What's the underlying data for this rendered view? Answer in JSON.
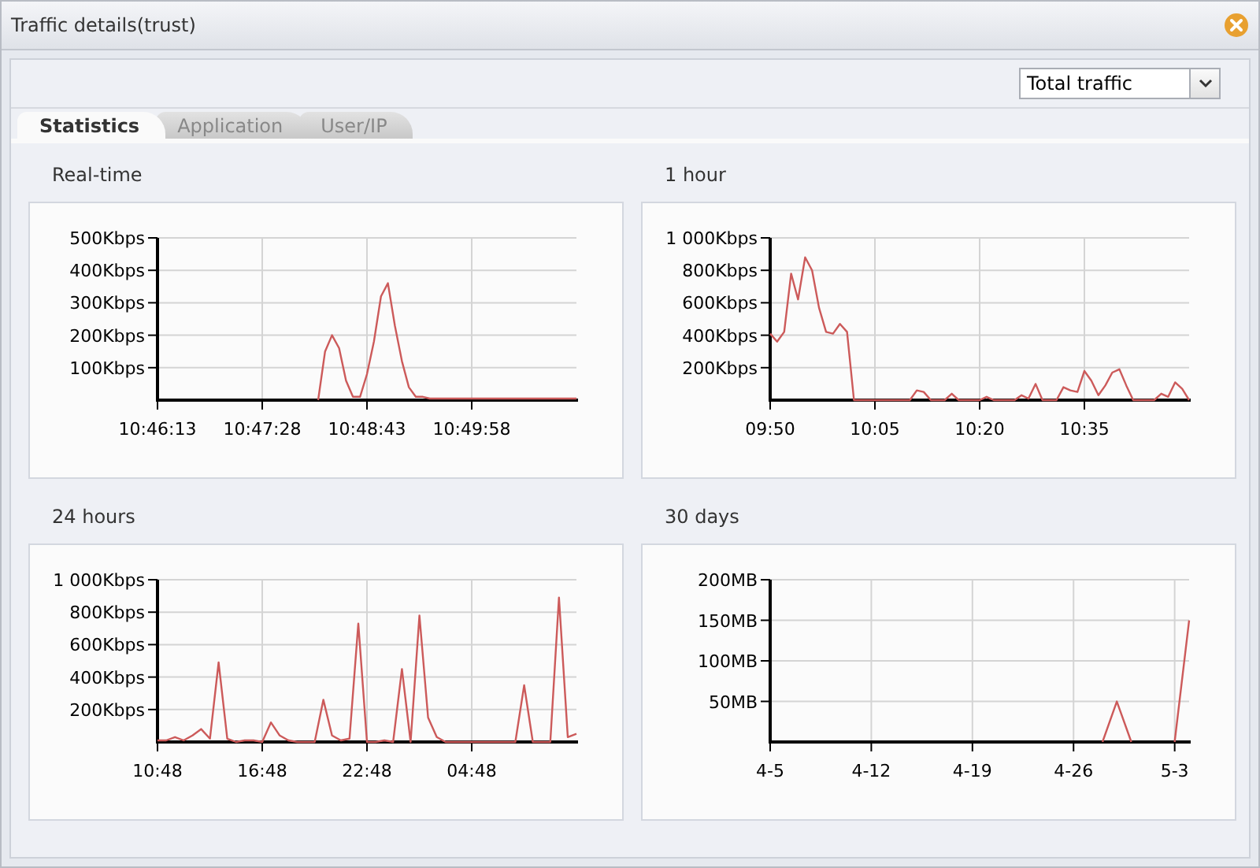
{
  "window": {
    "title": "Traffic details(trust)"
  },
  "filter": {
    "value": "Total traffic"
  },
  "tabs": [
    {
      "label": "Statistics",
      "selected": true
    },
    {
      "label": "Application",
      "selected": false
    },
    {
      "label": "User/IP",
      "selected": false
    }
  ],
  "panels": [
    {
      "title": "Real-time",
      "chart_data": {
        "type": "line",
        "categories": [
          "10:46:13",
          null,
          null,
          null,
          null,
          null,
          null,
          null,
          null,
          null,
          null,
          null,
          null,
          null,
          null,
          "10:47:28",
          null,
          null,
          null,
          null,
          null,
          null,
          null,
          null,
          null,
          null,
          null,
          null,
          null,
          null,
          "10:48:43",
          null,
          null,
          null,
          null,
          null,
          null,
          null,
          null,
          null,
          null,
          null,
          null,
          null,
          null,
          "10:49:58",
          null,
          null,
          null,
          null,
          null,
          null,
          null,
          null,
          null,
          null,
          null,
          null,
          null,
          null,
          null
        ],
        "series": [
          {
            "color": "#cc5a5a",
            "values": [
              null,
              null,
              null,
              null,
              null,
              null,
              null,
              null,
              null,
              null,
              null,
              null,
              null,
              null,
              null,
              null,
              null,
              null,
              null,
              null,
              null,
              null,
              null,
              0,
              150,
              200,
              160,
              60,
              10,
              10,
              80,
              180,
              320,
              360,
              230,
              120,
              40,
              10,
              10,
              5,
              5,
              5,
              5,
              5,
              5,
              5,
              5,
              5,
              5,
              5,
              5,
              5,
              5,
              5,
              5,
              5,
              5,
              5,
              5,
              5,
              5
            ]
          }
        ],
        "grid": true,
        "ylim": [
          0,
          500
        ],
        "yticks": [
          {
            "value": 100,
            "label": "100Kbps"
          },
          {
            "value": 200,
            "label": "200Kbps"
          },
          {
            "value": 300,
            "label": "300Kbps"
          },
          {
            "value": 400,
            "label": "400Kbps"
          },
          {
            "value": 500,
            "label": "500Kbps"
          }
        ]
      }
    },
    {
      "title": "1 hour",
      "chart_data": {
        "type": "line",
        "categories": [
          "09:50",
          null,
          null,
          null,
          null,
          null,
          null,
          null,
          null,
          null,
          null,
          null,
          null,
          null,
          null,
          "10:05",
          null,
          null,
          null,
          null,
          null,
          null,
          null,
          null,
          null,
          null,
          null,
          null,
          null,
          null,
          "10:20",
          null,
          null,
          null,
          null,
          null,
          null,
          null,
          null,
          null,
          null,
          null,
          null,
          null,
          null,
          "10:35",
          null,
          null,
          null,
          null,
          null,
          null,
          null,
          null,
          null,
          null,
          null,
          null,
          null,
          null,
          null
        ],
        "series": [
          {
            "color": "#cc5a5a",
            "values": [
              410,
              360,
              420,
              780,
              620,
              880,
              800,
              570,
              420,
              410,
              470,
              420,
              0,
              0,
              0,
              0,
              0,
              0,
              0,
              0,
              0,
              60,
              50,
              0,
              0,
              0,
              40,
              0,
              0,
              0,
              0,
              20,
              0,
              0,
              0,
              0,
              30,
              10,
              100,
              0,
              0,
              0,
              80,
              60,
              50,
              180,
              120,
              30,
              90,
              170,
              190,
              90,
              0,
              0,
              0,
              0,
              40,
              20,
              110,
              70,
              0
            ]
          }
        ],
        "grid": true,
        "ylim": [
          0,
          1000
        ],
        "yticks": [
          {
            "value": 200,
            "label": "200Kbps"
          },
          {
            "value": 400,
            "label": "400Kbps"
          },
          {
            "value": 600,
            "label": "600Kbps"
          },
          {
            "value": 800,
            "label": "800Kbps"
          },
          {
            "value": 1000,
            "label": "1 000Kbps"
          }
        ]
      }
    },
    {
      "title": "24 hours",
      "chart_data": {
        "type": "line",
        "categories": [
          "10:48",
          null,
          null,
          null,
          null,
          null,
          null,
          null,
          null,
          null,
          null,
          null,
          "16:48",
          null,
          null,
          null,
          null,
          null,
          null,
          null,
          null,
          null,
          null,
          null,
          "22:48",
          null,
          null,
          null,
          null,
          null,
          null,
          null,
          null,
          null,
          null,
          null,
          "04:48",
          null,
          null,
          null,
          null,
          null,
          null,
          null,
          null,
          null,
          null,
          null,
          null
        ],
        "series": [
          {
            "color": "#cc5a5a",
            "values": [
              10,
              10,
              30,
              10,
              40,
              80,
              20,
              490,
              20,
              0,
              10,
              10,
              0,
              120,
              40,
              10,
              0,
              0,
              0,
              260,
              40,
              10,
              20,
              730,
              0,
              0,
              10,
              0,
              450,
              0,
              780,
              150,
              30,
              0,
              0,
              0,
              0,
              0,
              0,
              0,
              0,
              0,
              350,
              0,
              0,
              0,
              890,
              30,
              50
            ]
          }
        ],
        "grid": true,
        "ylim": [
          0,
          1000
        ],
        "yticks": [
          {
            "value": 200,
            "label": "200Kbps"
          },
          {
            "value": 400,
            "label": "400Kbps"
          },
          {
            "value": 600,
            "label": "600Kbps"
          },
          {
            "value": 800,
            "label": "800Kbps"
          },
          {
            "value": 1000,
            "label": "1 000Kbps"
          }
        ]
      }
    },
    {
      "title": "30 days",
      "chart_data": {
        "type": "line",
        "categories": [
          "4-5",
          null,
          null,
          null,
          null,
          null,
          null,
          "4-12",
          null,
          null,
          null,
          null,
          null,
          null,
          "4-19",
          null,
          null,
          null,
          null,
          null,
          null,
          "4-26",
          null,
          null,
          null,
          null,
          null,
          null,
          "5-3",
          null
        ],
        "series": [
          {
            "color": "#cc5a5a",
            "values": [
              null,
              null,
              null,
              null,
              null,
              null,
              null,
              null,
              null,
              null,
              null,
              null,
              null,
              null,
              null,
              null,
              null,
              null,
              null,
              null,
              null,
              null,
              null,
              0,
              50,
              0,
              null,
              null,
              0,
              150
            ]
          }
        ],
        "grid": true,
        "ylim": [
          0,
          200
        ],
        "yticks": [
          {
            "value": 50,
            "label": "50MB"
          },
          {
            "value": 100,
            "label": "100MB"
          },
          {
            "value": 150,
            "label": "150MB"
          },
          {
            "value": 200,
            "label": "200MB"
          }
        ]
      }
    }
  ]
}
